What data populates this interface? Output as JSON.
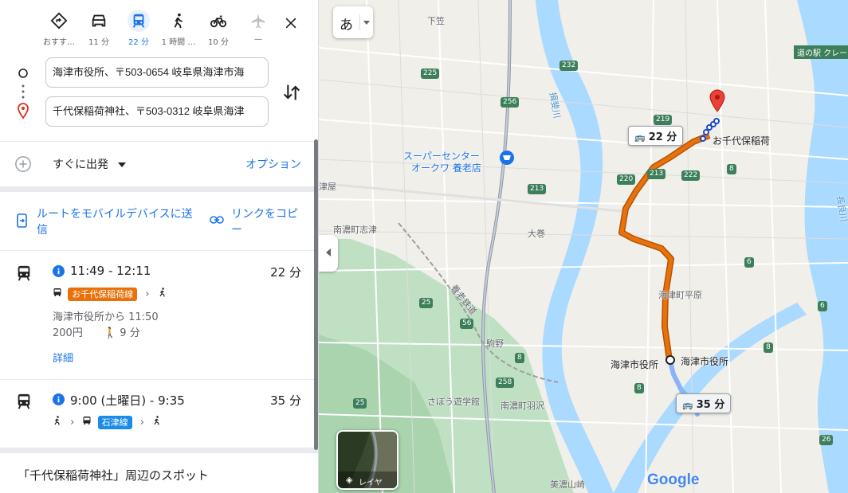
{
  "travel_modes": [
    {
      "label": "おすす…",
      "icon": "diamond-directions-icon"
    },
    {
      "label": "11 分",
      "icon": "car-icon"
    },
    {
      "label": "22 分",
      "icon": "transit-icon",
      "active": true
    },
    {
      "label": "1 時間 …",
      "icon": "walk-icon"
    },
    {
      "label": "10 分",
      "icon": "bicycle-icon"
    },
    {
      "label": "—",
      "icon": "flight-icon"
    }
  ],
  "origin": {
    "value": "海津市役所、〒503-0654 岐阜県海津市海"
  },
  "destination": {
    "value": "千代保稲荷神社、〒503-0312 岐阜県海津"
  },
  "depart": {
    "label": "すぐに出発",
    "options_label": "オプション"
  },
  "actions": {
    "send_to_device": "ルートをモバイルデバイスに送信",
    "copy_link": "リンクをコピー"
  },
  "routes": [
    {
      "time": "11:49 - 12:11",
      "duration": "22 分",
      "line_name": "お千代保稲荷線",
      "line_color": "#e8710a",
      "depart_from": "海津市役所から 11:50",
      "fare": "200円",
      "walk": "9 分",
      "details": "詳細"
    },
    {
      "time": "9:00 (土曜日) - 9:35",
      "duration": "35 分",
      "line_name": "石津線",
      "line_color": "#1a8ce8"
    }
  ],
  "nearby_heading": "「千代保稲荷神社」周辺のスポット",
  "map": {
    "ime_label": "あ",
    "layers_label": "レイヤ",
    "google_logo": "Google",
    "bubble_22": "22 分",
    "bubble_35": "35 分",
    "dest_label": "お千代保稲荷",
    "origin_label": "海津市役所",
    "origin_label2": "海津市役所",
    "store_label_1": "スーパーセンター",
    "store_label_2": "オークワ 養老店",
    "roadside_station": "道の駅 クレー",
    "labels": {
      "shimokasa": "下笠",
      "minami_shizu": "南濃町志津",
      "okiya": "津屋",
      "omaki": "大巻",
      "hirahara": "海津町平原",
      "komano": "駒野",
      "sahou": "さぼう遊学館",
      "hanesawa": "南濃町羽沢",
      "mino_yamazaki": "美濃山崎",
      "yoro_railway": "養老鉄道",
      "ibi_river": "揖斐川",
      "nagara_river": "長良川"
    },
    "shields": [
      "232",
      "225",
      "256",
      "219",
      "213",
      "220",
      "222",
      "213",
      "25",
      "56",
      "8",
      "258",
      "25",
      "8",
      "8",
      "8",
      "6",
      "6",
      "26"
    ]
  },
  "colors": {
    "transit_route": "#e8710a",
    "alt_route": "#8ab4f8",
    "walk_dots": "#1a47c9",
    "water": "#aadaff",
    "forest": "#bfe0c3",
    "accent": "#1a73e8"
  }
}
